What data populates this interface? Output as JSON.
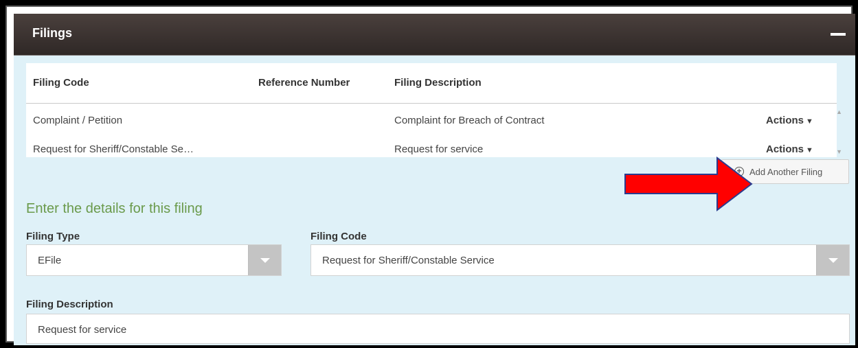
{
  "panel": {
    "title": "Filings"
  },
  "table": {
    "headers": [
      "Filing Code",
      "Reference Number",
      "Filing Description"
    ],
    "rows": [
      {
        "code": "Complaint / Petition",
        "ref": "",
        "desc": "Complaint for Breach of Contract",
        "actions": "Actions"
      },
      {
        "code": "Request for Sheriff/Constable Se…",
        "ref": "",
        "desc": "Request for service",
        "actions": "Actions"
      }
    ]
  },
  "add_button": {
    "label": "Add Another Filing"
  },
  "details": {
    "title": "Enter the details for this filing",
    "filing_type_label": "Filing Type",
    "filing_type_value": "EFile",
    "filing_code_label": "Filing Code",
    "filing_code_value": "Request for Sheriff/Constable Service",
    "filing_description_label": "Filing Description",
    "filing_description_value": "Request for service"
  },
  "annotation": {
    "arrow_color": "#ff0000",
    "arrow_outline": "#2a3b8f"
  }
}
